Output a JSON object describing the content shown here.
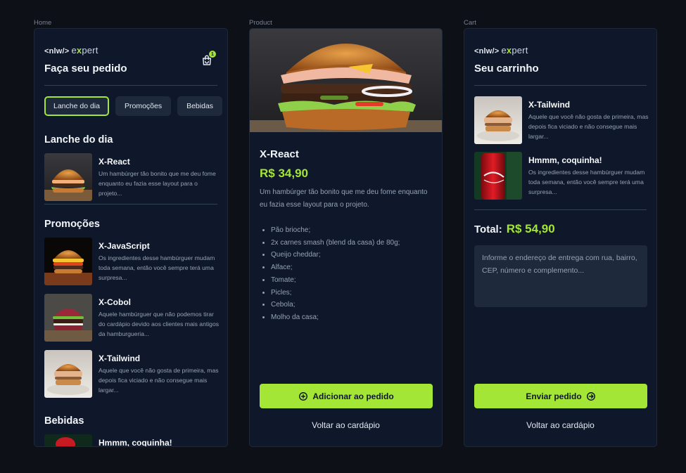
{
  "frames": {
    "home": "Home",
    "product": "Product",
    "cart": "Cart"
  },
  "logo": {
    "nlw": "<nlw/>",
    "pre": "e",
    "x": "x",
    "post": "pert"
  },
  "home": {
    "title": "Faça seu pedido",
    "cart_count": "1",
    "tabs": [
      "Lanche do dia",
      "Promoções",
      "Bebidas"
    ],
    "sections": {
      "daily": "Lanche do dia",
      "promos": "Promoções",
      "drinks": "Bebidas"
    },
    "items": [
      {
        "name": "X-React",
        "desc": "Um hambúrger tão bonito que me deu fome enquanto eu fazia esse layout para o projeto..."
      },
      {
        "name": "X-JavaScript",
        "desc": "Os ingredientes desse hambúrguer mudam toda semana, então você sempre terá uma surpresa..."
      },
      {
        "name": "X-Cobol",
        "desc": "Aquele hambúrguer que não podemos tirar do cardápio devido aos clientes mais antigos da hamburgueria..."
      },
      {
        "name": "X-Tailwind",
        "desc": "Aquele que você não gosta de primeira, mas depois fica viciado e não consegue mais largar..."
      },
      {
        "name": "Hmmm, coquinha!",
        "desc": ""
      }
    ]
  },
  "product": {
    "name": "X-React",
    "price": "R$ 34,90",
    "desc": "Um hambúrger tão bonito que me deu fome enquanto eu fazia esse layout para o projeto.",
    "ingredients": [
      "Pão brioche;",
      "2x carnes smash (blend da casa) de 80g;",
      "Queijo cheddar;",
      "Alface;",
      "Tomate;",
      "Picles;",
      "Cebola;",
      "Molho da casa;"
    ],
    "add_label": "Adicionar ao pedido",
    "back_label": "Voltar ao cardápio"
  },
  "cart": {
    "title": "Seu carrinho",
    "items": [
      {
        "name": "X-Tailwind",
        "desc": "Aquele que você não gosta de primeira, mas depois fica viciado e não consegue mais largar..."
      },
      {
        "name": "Hmmm, coquinha!",
        "desc": "Os ingredientes desse hambúrguer mudam toda semana, então você sempre terá uma surpresa..."
      }
    ],
    "total_label": "Total:",
    "total_value": "R$ 54,90",
    "address_placeholder": "Informe o endereço de entrega com rua, bairro, CEP, número e complemento...",
    "send_label": "Enviar pedido",
    "back_label": "Voltar ao cardápio"
  },
  "colors": {
    "accent": "#a3e635",
    "panel": "#0f172a",
    "surface": "#1e293b",
    "background": "#0d1017"
  }
}
